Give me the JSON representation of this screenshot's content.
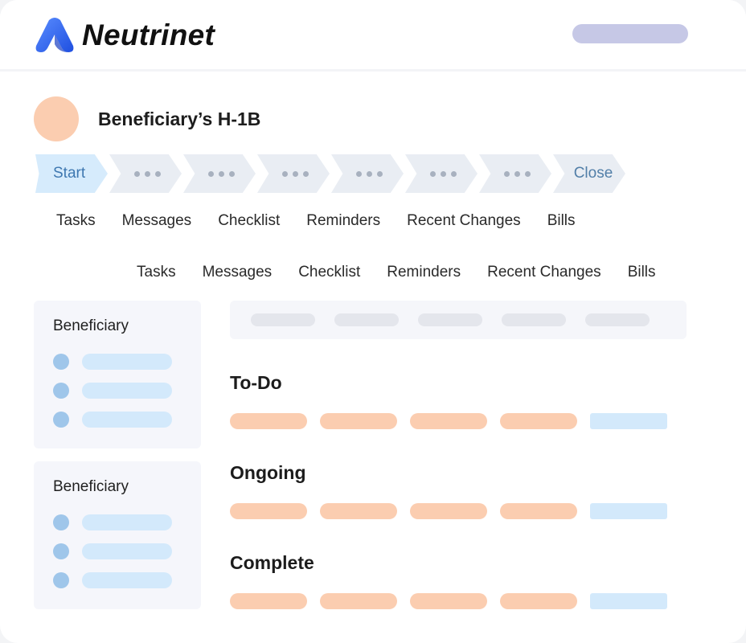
{
  "header": {
    "brand": "Neutrinet",
    "logo_icon": "neutrinet-logo-icon",
    "brand_color": "#2f6ff0"
  },
  "case": {
    "title": "Beneficiary’s H-1B",
    "avatar_color": "#fbcdb0"
  },
  "stepper": {
    "steps": [
      {
        "label": "Start",
        "active": true
      },
      {
        "label": "",
        "placeholder": "dots-icon"
      },
      {
        "label": "",
        "placeholder": "dots-icon"
      },
      {
        "label": "",
        "placeholder": "dots-icon"
      },
      {
        "label": "",
        "placeholder": "dots-icon"
      },
      {
        "label": "",
        "placeholder": "dots-icon"
      },
      {
        "label": "",
        "placeholder": "dots-icon"
      },
      {
        "label": "Close",
        "active": false
      }
    ]
  },
  "tabs_primary": [
    "Tasks",
    "Messages",
    "Checklist",
    "Reminders",
    "Recent Changes",
    "Bills"
  ],
  "tabs_secondary": [
    "Tasks",
    "Messages",
    "Checklist",
    "Reminders",
    "Recent Changes",
    "Bills"
  ],
  "side_panels": [
    {
      "title": "Beneficiary"
    },
    {
      "title": "Beneficiary"
    }
  ],
  "sections": [
    {
      "title": "To-Do"
    },
    {
      "title": "Ongoing"
    },
    {
      "title": "Complete"
    }
  ],
  "colors": {
    "accent_orange": "#fbcdb0",
    "accent_blue": "#d3e9fb",
    "step_active": "#d6ebfc",
    "step_inactive": "#e9edf3"
  }
}
